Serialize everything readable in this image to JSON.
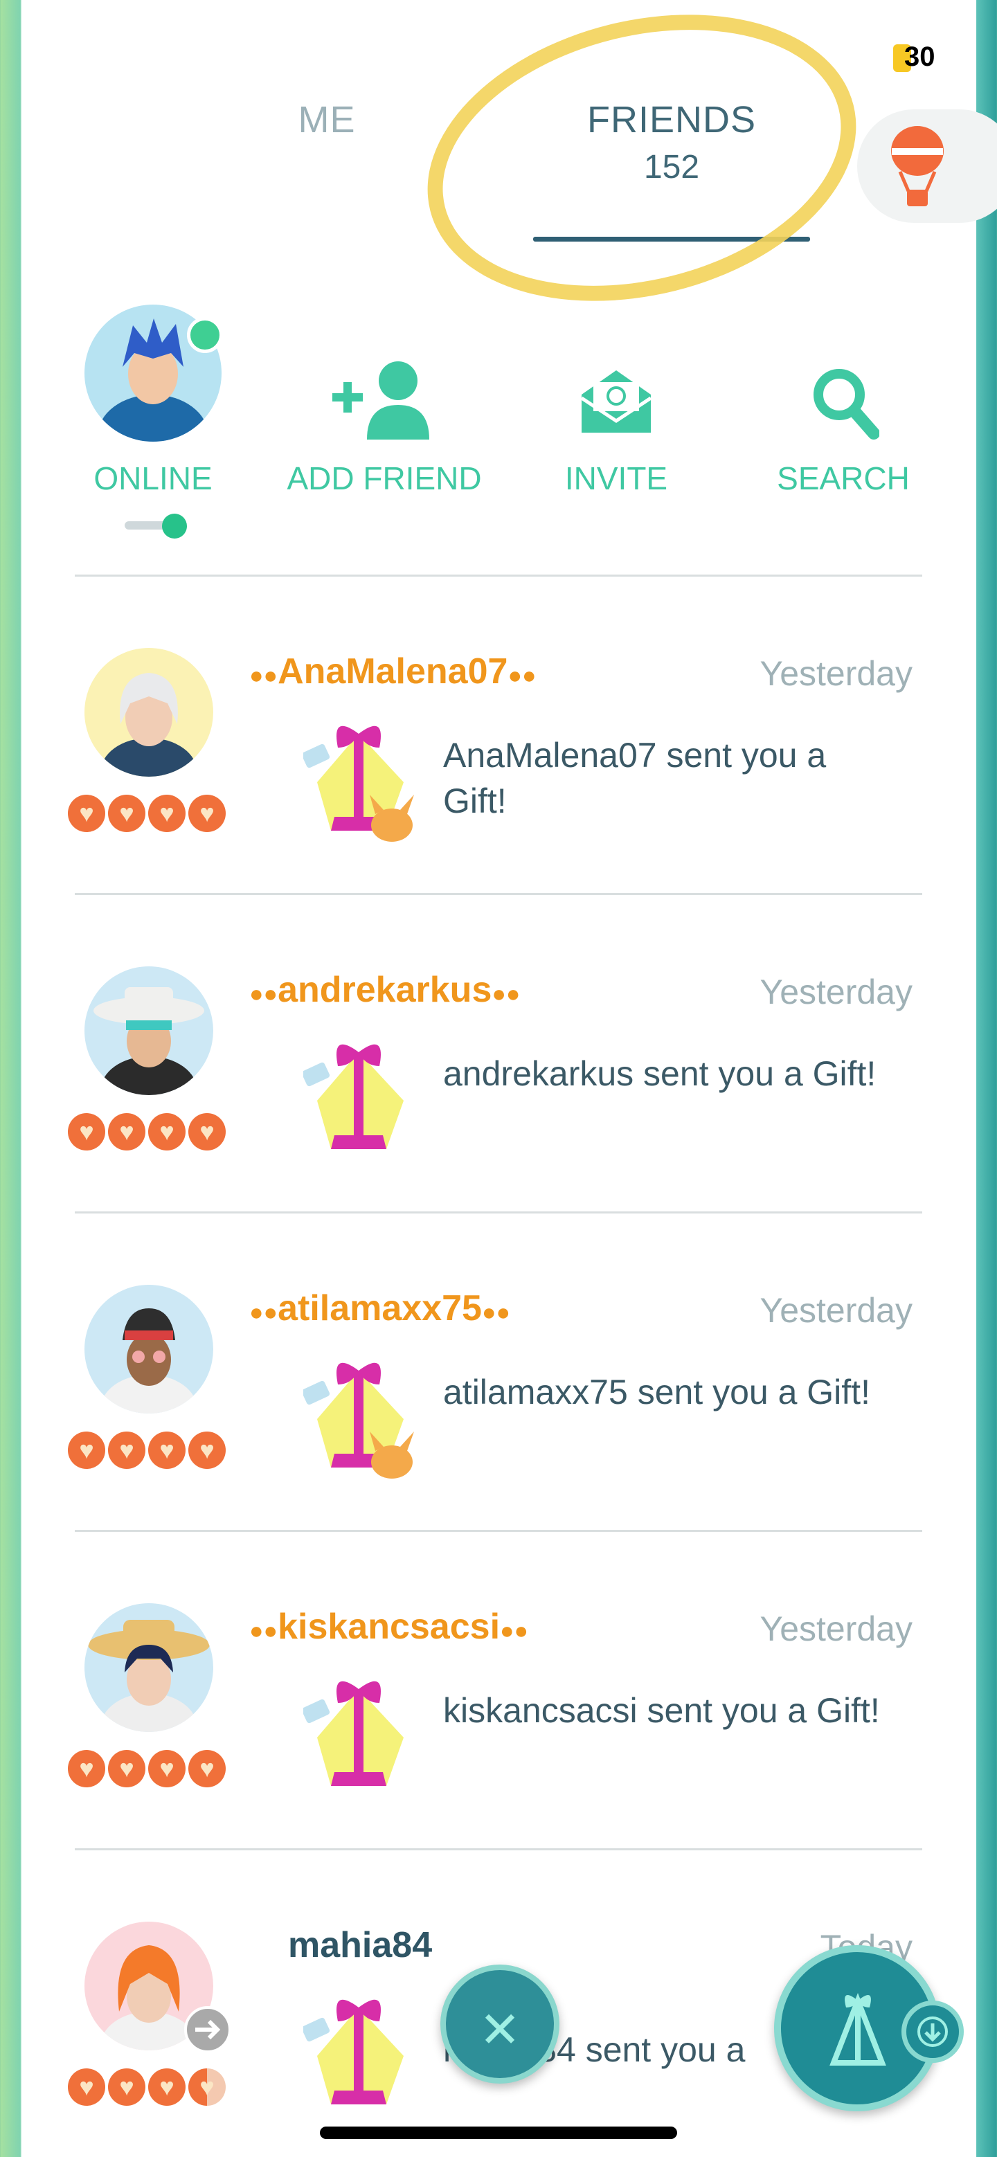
{
  "status": {
    "coins": "30"
  },
  "tabs": {
    "me_label": "ME",
    "friends_label": "FRIENDS",
    "friends_count": "152"
  },
  "actions": {
    "online": "ONLINE",
    "add_friend": "ADD FRIEND",
    "invite": "INVITE",
    "search": "SEARCH"
  },
  "friends": [
    {
      "name": "AnaMalena07",
      "time": "Yesterday",
      "message": "AnaMalena07 sent you a Gift!",
      "hearts": 4
    },
    {
      "name": "andrekarkus",
      "time": "Yesterday",
      "message": "andrekarkus sent you a Gift!",
      "hearts": 4
    },
    {
      "name": "atilamaxx75",
      "time": "Yesterday",
      "message": "atilamaxx75 sent you a Gift!",
      "hearts": 4
    },
    {
      "name": "kiskancsacsi",
      "time": "Yesterday",
      "message": "kiskancsacsi sent you a Gift!",
      "hearts": 4
    },
    {
      "name": "mahia84",
      "time": "Today",
      "message": "mahia84 sent you a",
      "hearts": 3.5
    }
  ],
  "colors": {
    "accent": "#3fc8a2",
    "name_orange": "#f0961c",
    "heart": "#f0703a",
    "tab_active": "#2f5f74"
  }
}
